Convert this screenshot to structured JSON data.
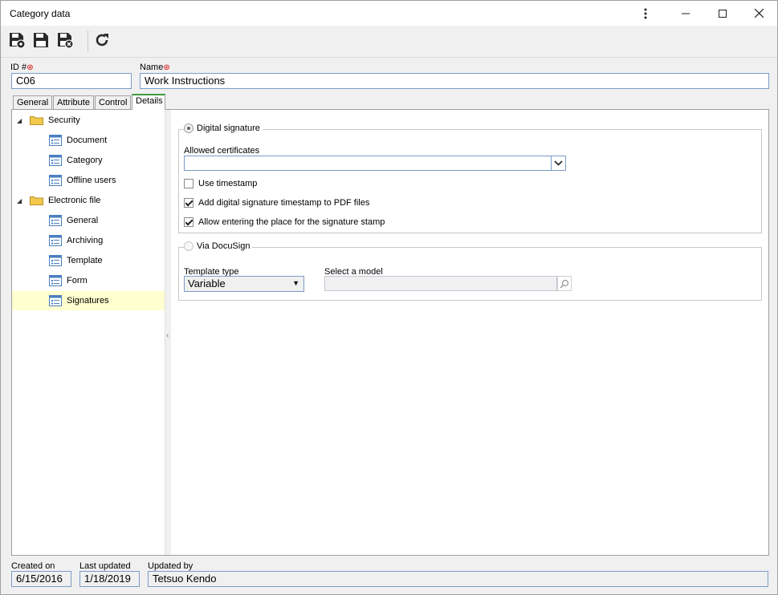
{
  "window": {
    "title": "Category data"
  },
  "header": {
    "id_label": "ID #",
    "id_value": "C06",
    "name_label": "Name",
    "name_value": "Work Instructions"
  },
  "tabs": [
    {
      "label": "General"
    },
    {
      "label": "Attribute"
    },
    {
      "label": "Control"
    },
    {
      "label": "Details"
    }
  ],
  "tree": {
    "groups": [
      {
        "label": "Security",
        "items": [
          "Document",
          "Category",
          "Offline users"
        ]
      },
      {
        "label": "Electronic file",
        "items": [
          "General",
          "Archiving",
          "Template",
          "Form",
          "Signatures"
        ]
      }
    ],
    "selected": "Signatures"
  },
  "digital_signature": {
    "title": "Digital signature",
    "allowed_certificates_label": "Allowed certificates",
    "allowed_certificates_value": "",
    "use_timestamp_label": "Use timestamp",
    "use_timestamp_checked": false,
    "add_timestamp_label": "Add digital signature timestamp to PDF files",
    "add_timestamp_checked": true,
    "allow_place_label": "Allow entering the place for the signature stamp",
    "allow_place_checked": true
  },
  "docusign": {
    "title": "Via DocuSign",
    "template_type_label": "Template type",
    "template_type_value": "Variable",
    "select_model_label": "Select a model",
    "select_model_value": ""
  },
  "footer": {
    "created_on_label": "Created on",
    "created_on_value": "6/15/2016",
    "last_updated_label": "Last updated",
    "last_updated_value": "1/18/2019",
    "updated_by_label": "Updated by",
    "updated_by_value": "Tetsuo Kendo"
  },
  "colors": {
    "active_tab_accent": "#3f9b3f",
    "selected_tree_row": "#ffffd0",
    "required_marker": "#d40000",
    "folder": "#f2c94c"
  }
}
